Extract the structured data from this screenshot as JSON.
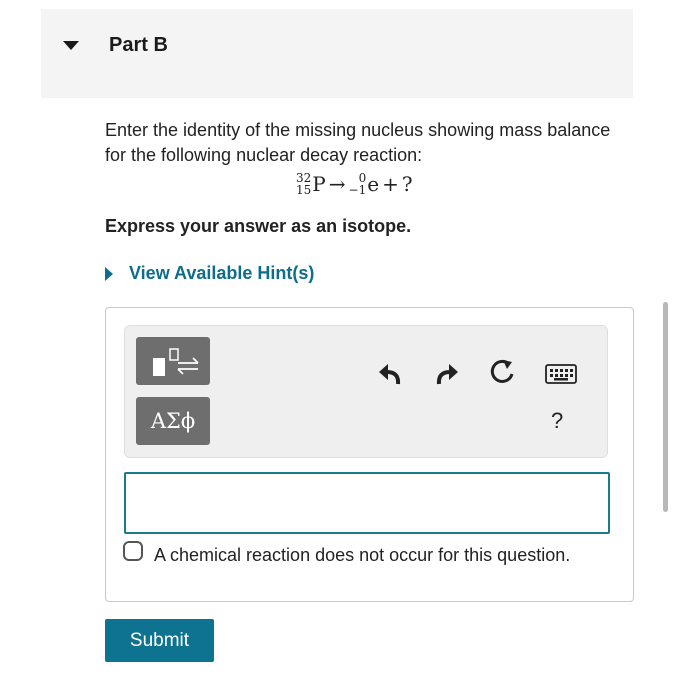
{
  "part": {
    "title": "Part B"
  },
  "prompt": {
    "text": "Enter the identity of the missing nucleus showing mass balance for the following nuclear decay reaction:",
    "equation": {
      "reactant": {
        "mass": "32",
        "atomic": "15",
        "symbol": "P"
      },
      "arrow": "→",
      "product": {
        "mass": "0",
        "atomic": "−1",
        "symbol": "e"
      },
      "plus": "+",
      "unknown": "?"
    }
  },
  "instruction": "Express your answer as an isotope.",
  "hint": {
    "label": "View Available Hint(s)"
  },
  "toolbar": {
    "symbols_label": "AΣϕ",
    "help_label": "?",
    "icons": [
      "templates-icon",
      "undo-icon",
      "redo-icon",
      "reset-icon",
      "keyboard-icon",
      "help-icon"
    ]
  },
  "answer": {
    "value": ""
  },
  "no_reaction": {
    "label": "A chemical reaction does not occur for this question.",
    "checked": false
  },
  "submit": {
    "label": "Submit"
  },
  "colors": {
    "accent": "#0e7390",
    "link": "#0e6d8c",
    "tool_button": "#6e6e6e"
  }
}
